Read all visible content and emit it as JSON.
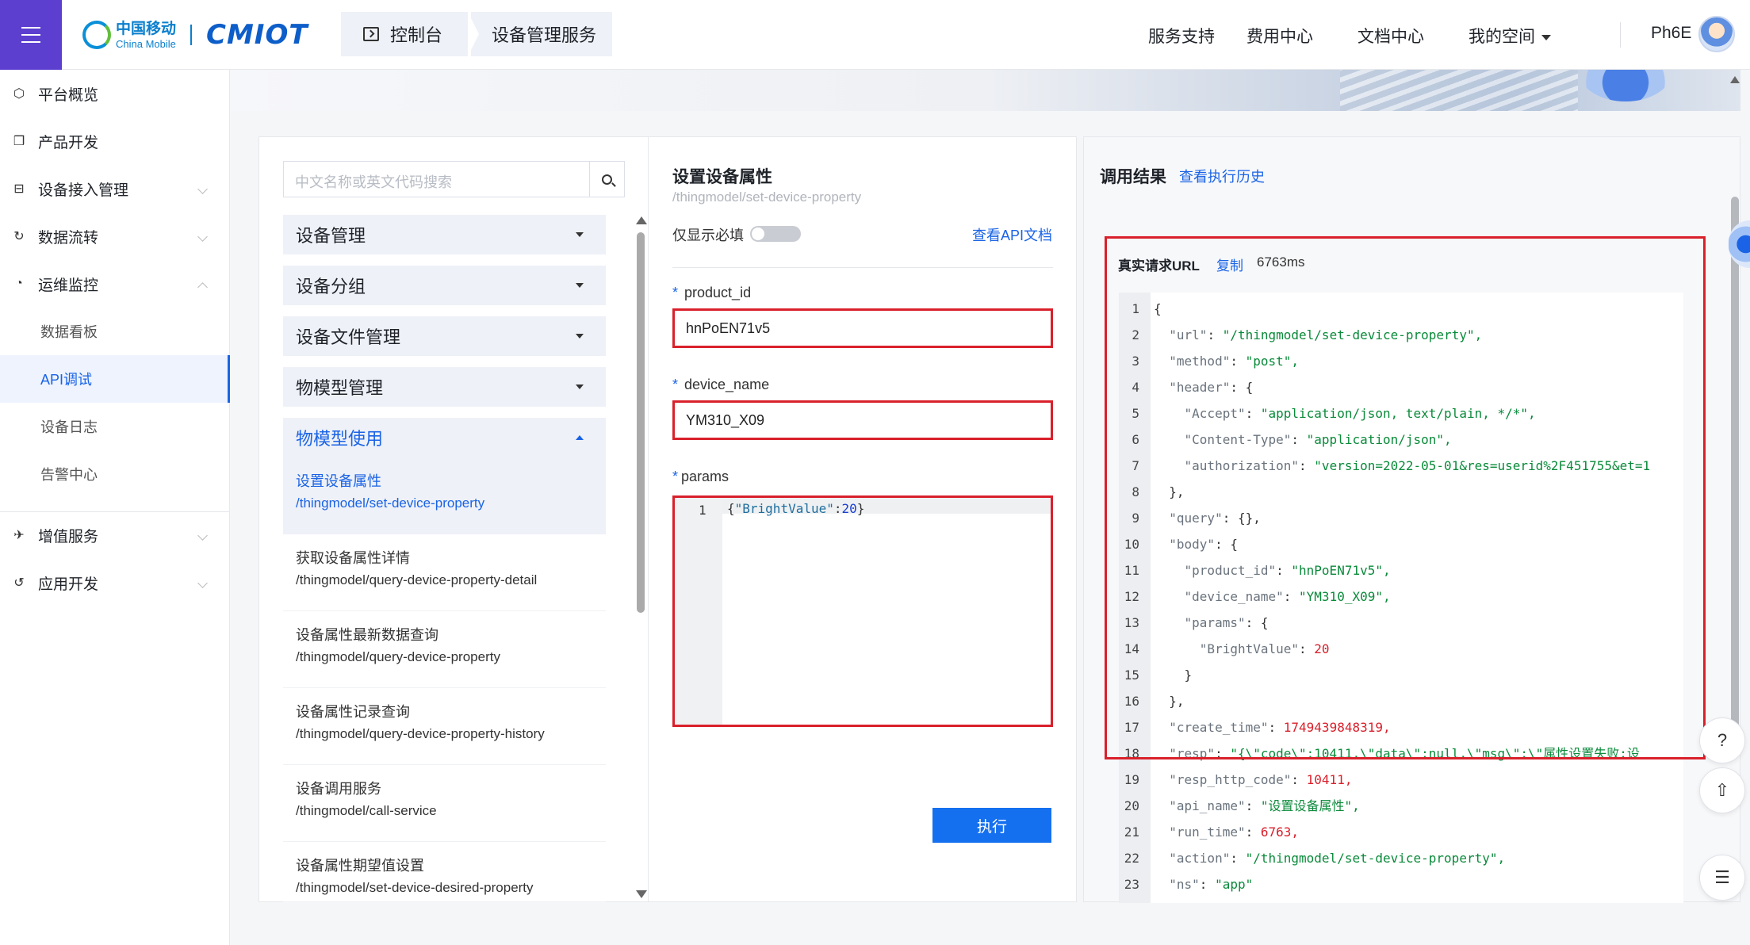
{
  "header": {
    "logo_cn": "中国移动",
    "logo_en": "China Mobile",
    "logo_iot": "CMIOT",
    "crumbs": [
      "控制台",
      "设备管理服务"
    ],
    "nav": [
      "服务支持",
      "费用中心",
      "文档中心",
      "我的空间"
    ],
    "username": "Ph6E"
  },
  "sidebar": {
    "items": [
      {
        "label": "平台概览",
        "icon": "overview-icon"
      },
      {
        "label": "产品开发",
        "icon": "cube-icon"
      },
      {
        "label": "设备接入管理",
        "icon": "device-access-icon"
      },
      {
        "label": "数据流转",
        "icon": "data-flow-icon"
      },
      {
        "label": "运维监控",
        "icon": "monitor-icon"
      }
    ],
    "sub_items": [
      "数据看板",
      "API调试",
      "设备日志",
      "告警中心"
    ],
    "bottom_items": [
      {
        "label": "增值服务",
        "icon": "value-added-icon"
      },
      {
        "label": "应用开发",
        "icon": "app-dev-icon"
      }
    ]
  },
  "api_list": {
    "search_placeholder": "中文名称或英文代码搜索",
    "categories": [
      "设备管理",
      "设备分组",
      "设备文件管理",
      "物模型管理",
      "物模型使用"
    ],
    "apis": [
      {
        "name": "设置设备属性",
        "path": "/thingmodel/set-device-property"
      },
      {
        "name": "获取设备属性详情",
        "path": "/thingmodel/query-device-property-detail"
      },
      {
        "name": "设备属性最新数据查询",
        "path": "/thingmodel/query-device-property"
      },
      {
        "name": "设备属性记录查询",
        "path": "/thingmodel/query-device-property-history"
      },
      {
        "name": "设备调用服务",
        "path": "/thingmodel/call-service"
      },
      {
        "name": "设备属性期望值设置",
        "path": "/thingmodel/set-device-desired-property"
      }
    ]
  },
  "form": {
    "title": "设置设备属性",
    "path": "/thingmodel/set-device-property",
    "required_only_label": "仅显示必填",
    "api_doc_link": "查看API文档",
    "fields": [
      {
        "label": "product_id",
        "value": "hnPoEN71v5"
      },
      {
        "label": "device_name",
        "value": "YM310_X09"
      }
    ],
    "params_label": "params",
    "params_line_no": "1",
    "params_key": "\"BrightValue\"",
    "params_value": "20",
    "execute_button": "执行"
  },
  "result": {
    "title": "调用结果",
    "history_link": "查看执行历史",
    "url_label": "真实请求URL",
    "copy_label": "复制",
    "time": "6763ms",
    "json_lines": [
      {
        "n": "1",
        "t": "{"
      },
      {
        "n": "2",
        "t": "  \"url\": \"/thingmodel/set-device-property\","
      },
      {
        "n": "3",
        "t": "  \"method\": \"post\","
      },
      {
        "n": "4",
        "t": "  \"header\": {"
      },
      {
        "n": "5",
        "t": "    \"Accept\": \"application/json, text/plain, */*\","
      },
      {
        "n": "6",
        "t": "    \"Content-Type\": \"application/json\","
      },
      {
        "n": "7",
        "t": "    \"authorization\": \"version=2022-05-01&res=userid%2F451755&et=1"
      },
      {
        "n": "8",
        "t": "  },"
      },
      {
        "n": "9",
        "t": "  \"query\": {},"
      },
      {
        "n": "10",
        "t": "  \"body\": {"
      },
      {
        "n": "11",
        "t": "    \"product_id\": \"hnPoEN71v5\","
      },
      {
        "n": "12",
        "t": "    \"device_name\": \"YM310_X09\","
      },
      {
        "n": "13",
        "t": "    \"params\": {"
      },
      {
        "n": "14",
        "t": "      \"BrightValue\": 20"
      },
      {
        "n": "15",
        "t": "    }"
      },
      {
        "n": "16",
        "t": "  },"
      },
      {
        "n": "17",
        "t": "  \"create_time\": 1749439848319,"
      },
      {
        "n": "18",
        "t": "  \"resp\": \"{\\\"code\\\":10411,\\\"data\\\":null,\\\"msg\\\":\\\"属性设置失败:设"
      },
      {
        "n": "19",
        "t": "  \"resp_http_code\": 10411,"
      },
      {
        "n": "20",
        "t": "  \"api_name\": \"设置设备属性\","
      },
      {
        "n": "21",
        "t": "  \"run_time\": 6763,"
      },
      {
        "n": "22",
        "t": "  \"action\": \"/thingmodel/set-device-property\","
      },
      {
        "n": "23",
        "t": "  \"ns\": \"app\""
      }
    ]
  },
  "colors": {
    "accent": "#1a63e6",
    "menu_bg": "#5c3fcf",
    "highlight_box": "#d9202b",
    "button": "#1570ef"
  }
}
